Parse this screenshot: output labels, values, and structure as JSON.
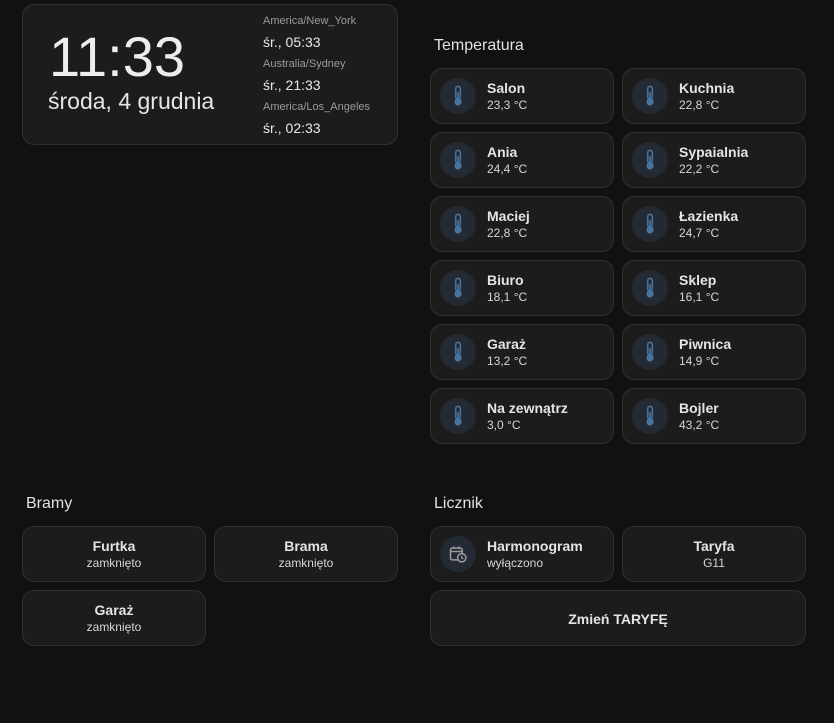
{
  "clock": {
    "time": "11:33",
    "date": "środa, 4 grudnia",
    "timezones": [
      {
        "name": "America/New_York",
        "time": "śr., 05:33"
      },
      {
        "name": "Australia/Sydney",
        "time": "śr., 21:33"
      },
      {
        "name": "America/Los_Angeles",
        "time": "śr., 02:33"
      }
    ]
  },
  "temperatura": {
    "title": "Temperatura",
    "icon": "thermometer-icon",
    "sensors": [
      {
        "name": "Salon",
        "value": "23,3 °C"
      },
      {
        "name": "Kuchnia",
        "value": "22,8 °C"
      },
      {
        "name": "Ania",
        "value": "24,4 °C"
      },
      {
        "name": "Sypaialnia",
        "value": "22,2 °C"
      },
      {
        "name": "Maciej",
        "value": "22,8 °C"
      },
      {
        "name": "Łazienka",
        "value": "24,7 °C"
      },
      {
        "name": "Biuro",
        "value": "18,1 °C"
      },
      {
        "name": "Sklep",
        "value": "16,1 °C"
      },
      {
        "name": "Garaż",
        "value": "13,2 °C"
      },
      {
        "name": "Piwnica",
        "value": "14,9 °C"
      },
      {
        "name": "Na zewnątrz",
        "value": "3,0 °C"
      },
      {
        "name": "Bojler",
        "value": "43,2 °C"
      }
    ]
  },
  "bramy": {
    "title": "Bramy",
    "items": [
      {
        "name": "Furtka",
        "state": "zamknięto"
      },
      {
        "name": "Brama",
        "state": "zamknięto"
      },
      {
        "name": "Garaż",
        "state": "zamknięto"
      }
    ]
  },
  "licznik": {
    "title": "Licznik",
    "harmonogram": {
      "name": "Harmonogram",
      "state": "wyłączono",
      "icon": "calendar-clock-icon"
    },
    "taryfa": {
      "name": "Taryfa",
      "state": "G11"
    },
    "zmien_button": "Zmień TARYFĘ"
  },
  "colors": {
    "background": "#111111",
    "card": "#1c1c1c",
    "icon_accent": "#44739e"
  }
}
